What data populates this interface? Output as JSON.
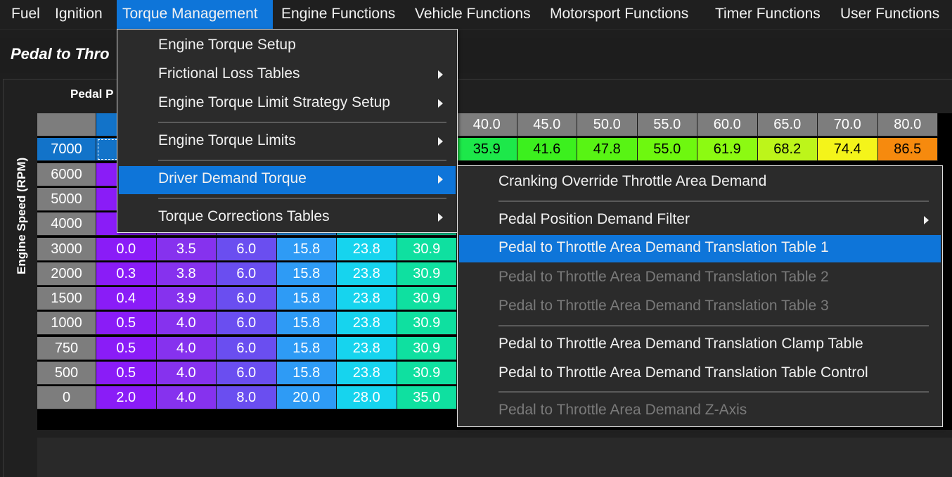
{
  "menubar": {
    "items": [
      {
        "label": "Fuel"
      },
      {
        "label": "Ignition"
      },
      {
        "label": "Torque Management"
      },
      {
        "label": "Engine Functions"
      },
      {
        "label": "Vehicle Functions"
      },
      {
        "label": "Motorsport Functions"
      },
      {
        "label": "Timer Functions"
      },
      {
        "label": "User Functions"
      }
    ]
  },
  "page": {
    "title": "Pedal to Thro"
  },
  "table": {
    "x_axis_title": "Pedal P",
    "y_axis_title": "Engine Speed (RPM)",
    "col_headers": [
      "",
      "",
      "",
      "",
      "",
      "",
      "40.0",
      "45.0",
      "50.0",
      "55.0",
      "60.0",
      "65.0",
      "70.0",
      "80.0"
    ],
    "rows": [
      {
        "rpm": "7000",
        "selected": true,
        "cells": [
          "",
          "",
          "",
          "",
          "",
          "",
          "35.9",
          "41.6",
          "47.8",
          "55.0",
          "61.9",
          "68.2",
          "74.4",
          "86.5"
        ]
      },
      {
        "rpm": "6000",
        "cells": [
          "",
          "",
          "",
          "",
          "",
          ""
        ]
      },
      {
        "rpm": "5000",
        "cells": [
          "",
          "",
          "",
          "",
          "",
          ""
        ]
      },
      {
        "rpm": "4000",
        "cells": [
          "",
          "",
          "",
          "",
          "",
          ""
        ]
      },
      {
        "rpm": "3000",
        "cells": [
          "0.0",
          "3.5",
          "6.0",
          "15.8",
          "23.8",
          "30.9"
        ]
      },
      {
        "rpm": "2000",
        "cells": [
          "0.3",
          "3.8",
          "6.0",
          "15.8",
          "23.8",
          "30.9"
        ]
      },
      {
        "rpm": "1500",
        "cells": [
          "0.4",
          "3.9",
          "6.0",
          "15.8",
          "23.8",
          "30.9"
        ]
      },
      {
        "rpm": "1000",
        "cells": [
          "0.5",
          "4.0",
          "6.0",
          "15.8",
          "23.8",
          "30.9"
        ]
      },
      {
        "rpm": "750",
        "cells": [
          "0.5",
          "4.0",
          "6.0",
          "15.8",
          "23.8",
          "30.9"
        ]
      },
      {
        "rpm": "500",
        "cells": [
          "0.5",
          "4.0",
          "6.0",
          "15.8",
          "23.8",
          "30.9"
        ]
      },
      {
        "rpm": "0",
        "cells": [
          "2.0",
          "4.0",
          "8.0",
          "20.0",
          "28.0",
          "35.0"
        ]
      }
    ]
  },
  "torque_menu": {
    "items": [
      {
        "label": "Engine Torque Setup",
        "submenu": false
      },
      {
        "label": "Frictional Loss Tables",
        "submenu": true
      },
      {
        "label": "Engine Torque Limit Strategy Setup",
        "submenu": true
      },
      {
        "label": "Engine Torque Limits",
        "submenu": true
      },
      {
        "label": "Driver Demand Torque",
        "submenu": true
      },
      {
        "label": "Torque Corrections Tables",
        "submenu": true
      }
    ]
  },
  "driver_demand_menu": {
    "items": [
      {
        "label": "Cranking Override Throttle Area Demand",
        "submenu": false,
        "disabled": false
      },
      {
        "label": "Pedal Position Demand Filter",
        "submenu": true,
        "disabled": false
      },
      {
        "label": "Pedal to Throttle Area Demand Translation Table 1",
        "submenu": false,
        "disabled": false
      },
      {
        "label": "Pedal to Throttle Area Demand Translation Table 2",
        "submenu": false,
        "disabled": true
      },
      {
        "label": "Pedal to Throttle Area Demand Translation Table 3",
        "submenu": false,
        "disabled": true
      },
      {
        "label": "Pedal to Throttle Area Demand Translation Clamp Table",
        "submenu": false,
        "disabled": false
      },
      {
        "label": "Pedal to Throttle Area Demand Translation Table Control",
        "submenu": false,
        "disabled": false
      },
      {
        "label": "Pedal to Throttle Area Demand Z-Axis",
        "submenu": false,
        "disabled": true
      }
    ]
  },
  "colors": {
    "accent": "#0e75d9",
    "header_gray": "#7d7d7d"
  }
}
